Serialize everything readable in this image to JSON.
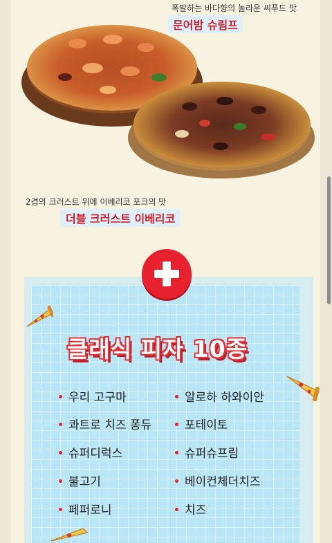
{
  "promo": {
    "pizza1": {
      "caption": "폭발하는 바다향의 놀라운 씨푸드 맛",
      "name": "문어밤 슈림프"
    },
    "pizza2": {
      "caption": "2겹의 크러스트 위에 이베리코 포크의 맛",
      "name": "더블 크러스트 이베리코"
    }
  },
  "classic": {
    "title": "클래식 피자 10종",
    "left_items": [
      "우리 고구마",
      "콰트로 치즈 퐁듀",
      "슈퍼디럭스",
      "불고기",
      "페퍼로니"
    ],
    "right_items": [
      "알로하 하와이안",
      "포테이토",
      "슈퍼슈프림",
      "베이컨체더치즈",
      "치즈"
    ]
  },
  "colors": {
    "accent": "#e8212f",
    "card": "#b9e6f7",
    "page": "#f8f3e1"
  },
  "icons": [
    "plus-icon",
    "pizza-slice-icon"
  ]
}
